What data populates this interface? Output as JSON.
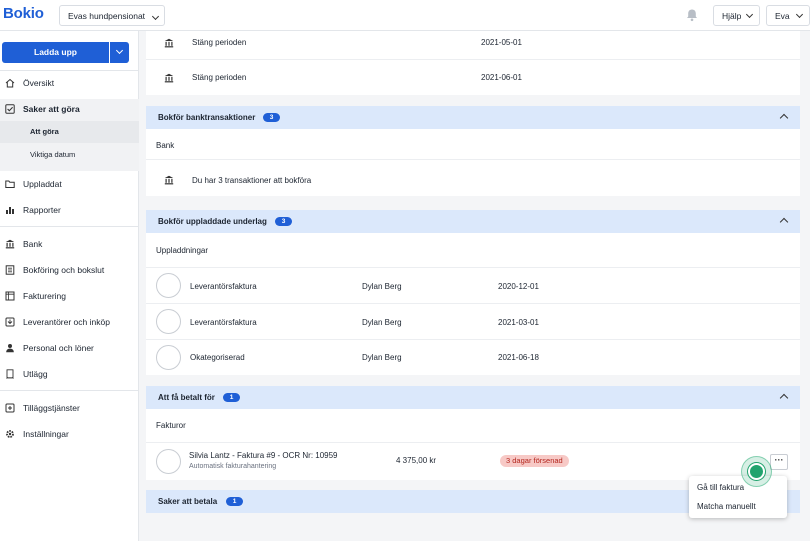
{
  "topbar": {
    "logo": "Bokio",
    "company": "Evas hundpensionat",
    "help": "Hjälp",
    "user": "Eva"
  },
  "sidebar": {
    "upload_label": "Ladda upp",
    "items": [
      {
        "label": "Översikt",
        "icon": "home-icon"
      },
      {
        "label": "Saker att göra",
        "icon": "checkbox-icon"
      },
      {
        "label": "Att göra",
        "icon": ""
      },
      {
        "label": "Viktiga datum",
        "icon": ""
      },
      {
        "label": "Uppladdat",
        "icon": "folder-icon"
      },
      {
        "label": "Rapporter",
        "icon": "chart-icon"
      },
      {
        "label": "Bank",
        "icon": "bank-icon"
      },
      {
        "label": "Bokföring och bokslut",
        "icon": "ledger-icon"
      },
      {
        "label": "Fakturering",
        "icon": "invoice-icon"
      },
      {
        "label": "Leverantörer och inköp",
        "icon": "inbox-icon"
      },
      {
        "label": "Personal och löner",
        "icon": "person-icon"
      },
      {
        "label": "Utlägg",
        "icon": "receipt-icon"
      },
      {
        "label": "Tilläggstjänster",
        "icon": "addon-icon"
      },
      {
        "label": "Inställningar",
        "icon": "gear-icon"
      }
    ]
  },
  "periods": [
    {
      "label": "Stäng perioden",
      "date": "2021-05-01"
    },
    {
      "label": "Stäng perioden",
      "date": "2021-06-01"
    }
  ],
  "bank_section": {
    "title": "Bokför banktransaktioner",
    "count": "3",
    "subtitle": "Bank",
    "row_text": "Du har 3 transaktioner att bokföra"
  },
  "uploads_section": {
    "title": "Bokför uppladdade underlag",
    "count": "3",
    "subtitle": "Uppladdningar",
    "rows": [
      {
        "type": "Leverantörsfaktura",
        "person": "Dylan Berg",
        "date": "2020-12-01"
      },
      {
        "type": "Leverantörsfaktura",
        "person": "Dylan Berg",
        "date": "2021-03-01"
      },
      {
        "type": "Okategoriserad",
        "person": "Dylan Berg",
        "date": "2021-06-18"
      }
    ]
  },
  "paid_section": {
    "title": "Att få betalt för",
    "count": "1",
    "subtitle": "Fakturor",
    "invoice": {
      "title": "Silvia Lantz - Faktura #9 - OCR Nr: 10959",
      "subtext": "Automatisk fakturahantering",
      "amount": "4 375,00 kr",
      "status": "3 dagar försenad"
    }
  },
  "pay_section": {
    "title": "Saker att betala",
    "count": "1"
  },
  "context_menu": {
    "items": [
      "Gå till faktura",
      "Matcha manuellt"
    ]
  },
  "colors": {
    "brand": "#1f5fd6",
    "section_header": "#dbe8fb",
    "overdue_bg": "#f7c9c6",
    "cursor": "#22a36e"
  }
}
